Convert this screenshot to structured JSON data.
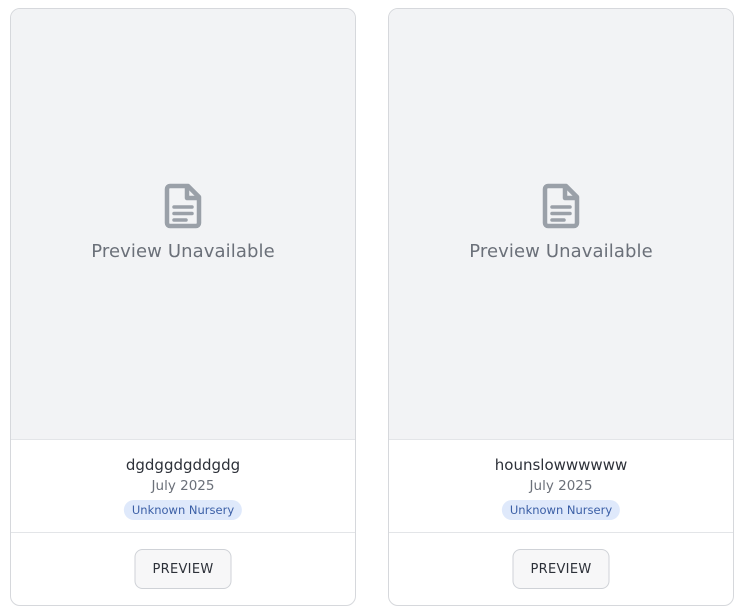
{
  "cards": [
    {
      "preview_text": "Preview Unavailable",
      "icon": "document-icon",
      "title": "dgdggdgddgdg",
      "date": "July 2025",
      "badge": "Unknown Nursery",
      "button_label": "PREVIEW"
    },
    {
      "preview_text": "Preview Unavailable",
      "icon": "document-icon",
      "title": "hounslowwwwww",
      "date": "July 2025",
      "badge": "Unknown Nursery",
      "button_label": "PREVIEW"
    }
  ],
  "colors": {
    "preview_bg": "#f2f3f5",
    "icon": "#9aa0a8",
    "badge_bg": "#dfe9fb",
    "badge_text": "#3b5fa6"
  }
}
